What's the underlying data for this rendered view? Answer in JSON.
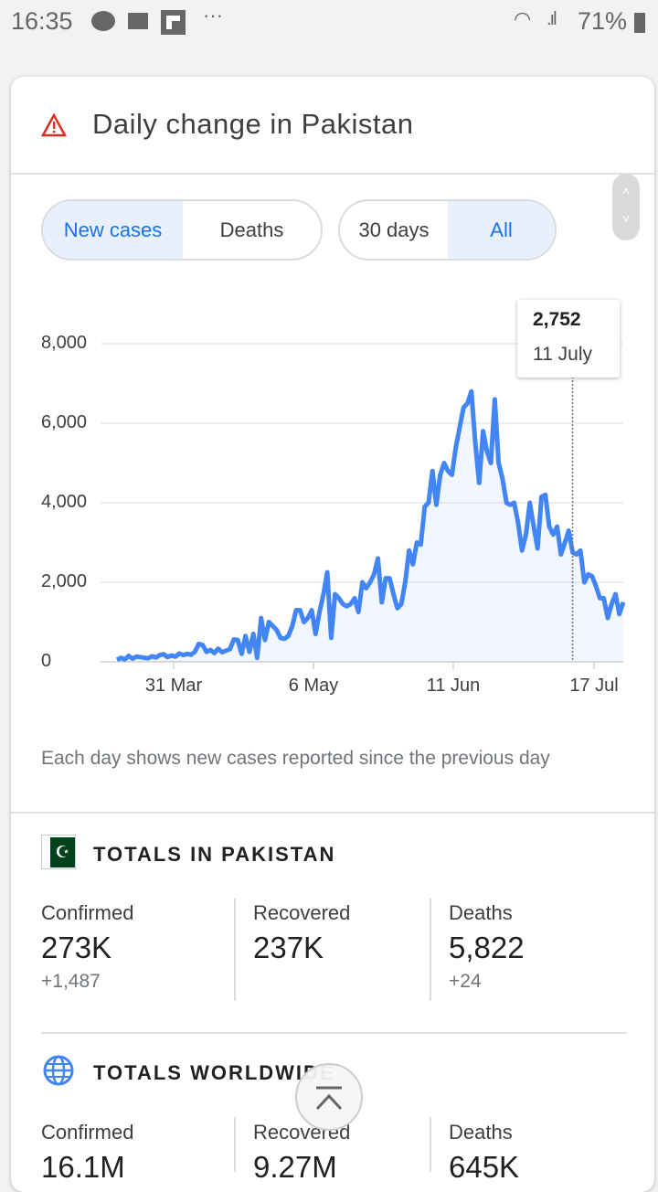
{
  "status_bar": {
    "time": "16:35",
    "battery": "71%",
    "icons": [
      "bubble-app-icon",
      "message-icon",
      "flipboard-icon",
      "more-dots-icon",
      "wifi-icon",
      "signal-icon",
      "battery-icon"
    ]
  },
  "header": {
    "title": "Daily change in Pakistan",
    "icon": "warning-triangle-icon"
  },
  "toggles": {
    "metric": [
      "New cases",
      "Deaths"
    ],
    "metric_selected": "New cases",
    "range": [
      "30 days",
      "All"
    ],
    "range_selected": "All"
  },
  "tooltip": {
    "value": "2,752",
    "date": "11 July"
  },
  "footnote": "Each day shows new cases reported since the previous day",
  "colors": {
    "accent": "#4285f4",
    "selected_bg": "#e8f0fe",
    "warning": "#d93025"
  },
  "chart_data": {
    "type": "area",
    "ylim": [
      0,
      8000
    ],
    "y_ticks": [
      "0",
      "2,000",
      "4,000",
      "6,000",
      "8,000"
    ],
    "y_tick_values": [
      0,
      2000,
      4000,
      6000,
      8000
    ],
    "x_ticks": [
      "31 Mar",
      "6 May",
      "11 Jun",
      "17 Jul"
    ],
    "grid": true,
    "x": [
      "16 Mar",
      "17 Mar",
      "18 Mar",
      "19 Mar",
      "20 Mar",
      "21 Mar",
      "22 Mar",
      "23 Mar",
      "24 Mar",
      "25 Mar",
      "26 Mar",
      "27 Mar",
      "28 Mar",
      "29 Mar",
      "30 Mar",
      "31 Mar",
      "1 Apr",
      "2 Apr",
      "3 Apr",
      "4 Apr",
      "5 Apr",
      "6 Apr",
      "7 Apr",
      "8 Apr",
      "9 Apr",
      "10 Apr",
      "11 Apr",
      "12 Apr",
      "13 Apr",
      "14 Apr",
      "15 Apr",
      "16 Apr",
      "17 Apr",
      "18 Apr",
      "19 Apr",
      "20 Apr",
      "21 Apr",
      "22 Apr",
      "23 Apr",
      "24 Apr",
      "25 Apr",
      "26 Apr",
      "27 Apr",
      "28 Apr",
      "29 Apr",
      "30 Apr",
      "1 May",
      "2 May",
      "3 May",
      "4 May",
      "5 May",
      "6 May",
      "7 May",
      "8 May",
      "9 May",
      "10 May",
      "11 May",
      "12 May",
      "13 May",
      "14 May",
      "15 May",
      "16 May",
      "17 May",
      "18 May",
      "19 May",
      "20 May",
      "21 May",
      "22 May",
      "23 May",
      "24 May",
      "25 May",
      "26 May",
      "27 May",
      "28 May",
      "29 May",
      "30 May",
      "31 May",
      "1 Jun",
      "2 Jun",
      "3 Jun",
      "4 Jun",
      "5 Jun",
      "6 Jun",
      "7 Jun",
      "8 Jun",
      "9 Jun",
      "10 Jun",
      "11 Jun",
      "12 Jun",
      "13 Jun",
      "14 Jun",
      "15 Jun",
      "16 Jun",
      "17 Jun",
      "18 Jun",
      "19 Jun",
      "20 Jun",
      "21 Jun",
      "22 Jun",
      "23 Jun",
      "24 Jun",
      "25 Jun",
      "26 Jun",
      "27 Jun",
      "28 Jun",
      "29 Jun",
      "30 Jun",
      "1 Jul",
      "2 Jul",
      "3 Jul",
      "4 Jul",
      "5 Jul",
      "6 Jul",
      "7 Jul",
      "8 Jul",
      "9 Jul",
      "10 Jul",
      "11 Jul",
      "12 Jul",
      "13 Jul",
      "14 Jul",
      "15 Jul",
      "16 Jul",
      "17 Jul",
      "18 Jul",
      "19 Jul",
      "20 Jul",
      "21 Jul",
      "22 Jul",
      "23 Jul",
      "24 Jul"
    ],
    "series": [
      {
        "values": [
          50,
          100,
          60,
          150,
          80,
          130,
          120,
          100,
          90,
          140,
          110,
          170,
          190,
          120,
          160,
          130,
          210,
          170,
          200,
          180,
          250,
          450,
          420,
          250,
          300,
          220,
          330,
          240,
          280,
          320,
          560,
          550,
          200,
          650,
          250,
          700,
          100,
          1100,
          550,
          1000,
          900,
          800,
          600,
          580,
          650,
          900,
          1300,
          1300,
          1000,
          1100,
          1300,
          700,
          1250,
          1700,
          2250,
          600,
          1700,
          1600,
          1450,
          1400,
          1450,
          1600,
          1250,
          2000,
          1850,
          2000,
          2200,
          2600,
          1500,
          2100,
          2100,
          1700,
          1350,
          1450,
          2000,
          2800,
          2450,
          3000,
          2950,
          3900,
          4000,
          4800,
          3950,
          4700,
          5000,
          4800,
          4700,
          5400,
          5900,
          6400,
          6500,
          6800,
          5500,
          4500,
          5800,
          5300,
          5000,
          6600,
          5000,
          4600,
          4000,
          3950,
          4000,
          3500,
          2800,
          3200,
          4000,
          3400,
          2850,
          4150,
          4200,
          3400,
          3200,
          3400,
          2700,
          3000,
          3300,
          2752,
          2700,
          2800,
          2000,
          2200,
          2150,
          1900,
          1600,
          1600,
          1100,
          1450,
          1700,
          1200,
          1500
        ]
      }
    ],
    "highlight": {
      "x": "11 Jul",
      "value": 2752
    }
  },
  "pakistan": {
    "title": "TOTALS IN PAKISTAN",
    "icon": "pakistan-flag-icon",
    "stats": [
      {
        "label": "Confirmed",
        "value": "273K",
        "delta": "+1,487"
      },
      {
        "label": "Recovered",
        "value": "237K",
        "delta": ""
      },
      {
        "label": "Deaths",
        "value": "5,822",
        "delta": "+24"
      }
    ]
  },
  "worldwide": {
    "title": "TOTALS WORLDWIDE",
    "icon": "globe-icon",
    "stats": [
      {
        "label": "Confirmed",
        "value": "16.1M"
      },
      {
        "label": "Recovered",
        "value": "9.27M"
      },
      {
        "label": "Deaths",
        "value": "645K"
      }
    ]
  }
}
